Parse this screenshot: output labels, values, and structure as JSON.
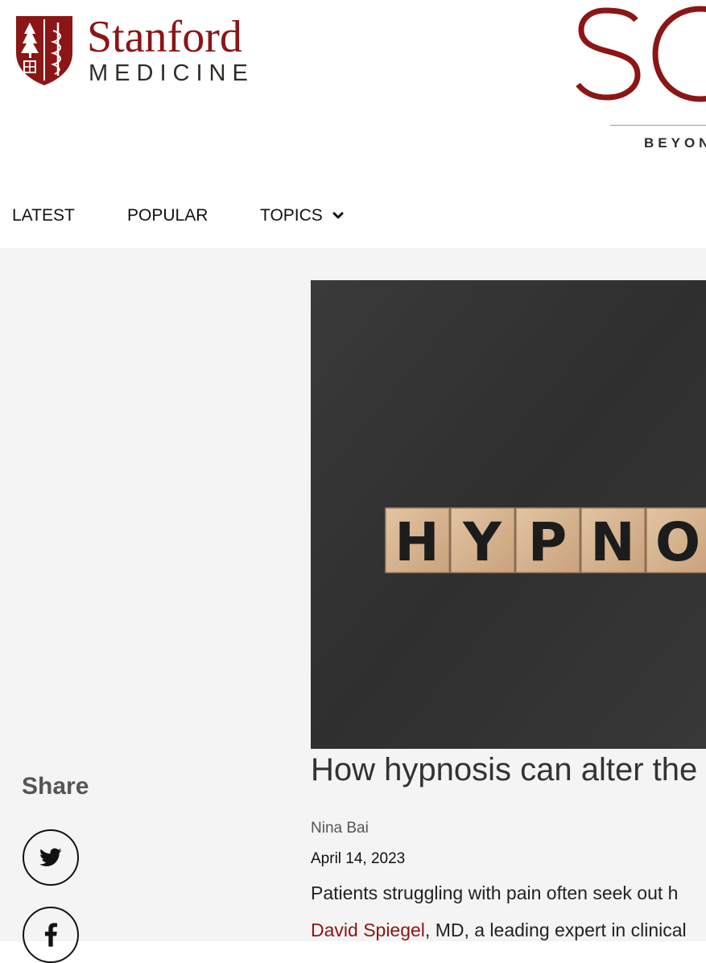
{
  "logo": {
    "name": "Stanford",
    "sub": "MEDICINE"
  },
  "brand": {
    "big": "SC",
    "tagline": "BEYON"
  },
  "nav": {
    "items": [
      {
        "label": "LATEST"
      },
      {
        "label": "POPULAR"
      },
      {
        "label": "TOPICS"
      }
    ]
  },
  "hero": {
    "letters": [
      "H",
      "Y",
      "P",
      "N",
      "O"
    ]
  },
  "share": {
    "label": "Share",
    "buttons": [
      "twitter-icon",
      "facebook-icon"
    ]
  },
  "article": {
    "title": "How hypnosis can alter the",
    "author": "Nina Bai",
    "date": "April 14, 2023",
    "para1": "Patients struggling with pain often seek out h",
    "link": "David Spiegel",
    "para2_rest": ", MD, a leading expert in clinical"
  },
  "colors": {
    "accent": "#8c1515",
    "background": "#f4f4f4",
    "hero": "#333333"
  }
}
